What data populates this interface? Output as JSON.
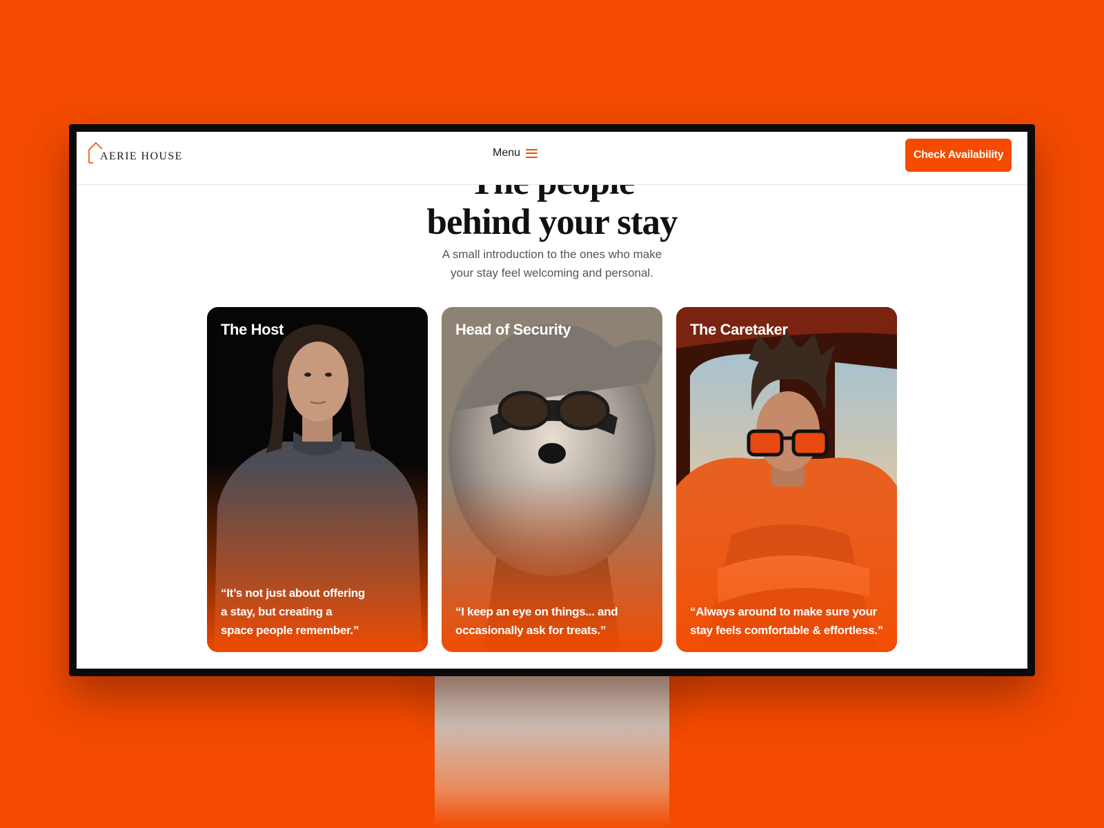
{
  "brand": {
    "name": "AERIE HOUSE"
  },
  "nav": {
    "menu_label": "Menu",
    "cta_label": "Check Availability"
  },
  "hero": {
    "heading_lines": [
      "The people",
      "behind your stay"
    ],
    "subtitle_lines": [
      "A small introduction to the ones who make",
      "your stay feel welcoming and personal."
    ]
  },
  "cards": [
    {
      "title": "The Host",
      "quote_lines": [
        "“It’s not just about offering",
        "a stay, but creating a",
        "space people remember.”"
      ]
    },
    {
      "title": "Head of Security",
      "quote_lines": [
        "“I keep an eye on things... and",
        "occasionally ask for treats.”"
      ]
    },
    {
      "title": "The Caretaker",
      "quote_lines": [
        "“Always around to make sure your",
        "stay feels comfortable & effortless.”"
      ]
    }
  ],
  "colors": {
    "accent": "#f44b00",
    "page_bg": "#f44b00",
    "text": "#111111",
    "muted": "#555555"
  }
}
